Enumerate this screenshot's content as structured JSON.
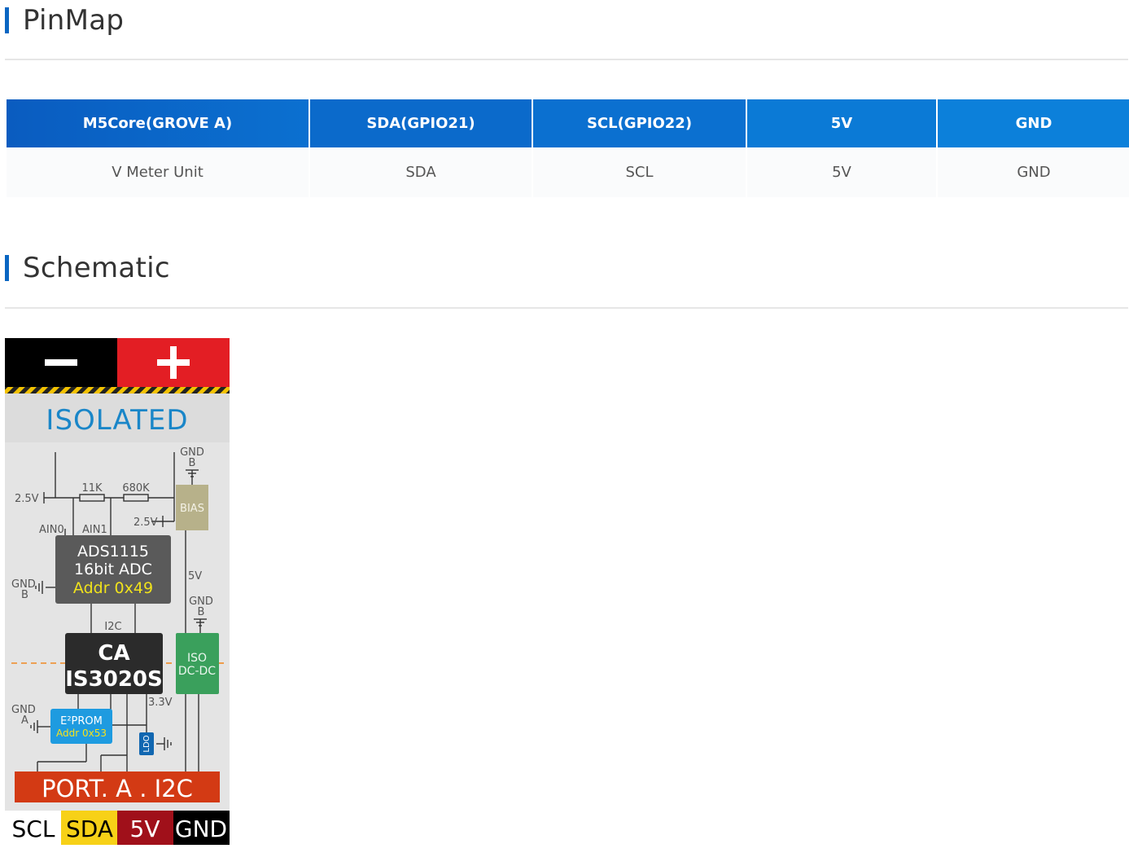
{
  "pinmap": {
    "title": "PinMap",
    "headers": [
      "M5Core(GROVE A)",
      "SDA(GPIO21)",
      "SCL(GPIO22)",
      "5V",
      "GND"
    ],
    "row": [
      "V Meter Unit",
      "SDA",
      "SCL",
      "5V",
      "GND"
    ]
  },
  "schematic": {
    "title": "Schematic",
    "isolated": "ISOLATED",
    "r1": "11K",
    "r2": "680K",
    "v25_left": "2.5V",
    "v25_right": "2.5V",
    "ain0": "AIN0",
    "ain1": "AIN1",
    "gndb_top_1": "GND",
    "gndb_top_2": "B",
    "bias": "BIAS",
    "adc_line1": "ADS1115",
    "adc_line2": "16bit ADC",
    "adc_line3": "Addr 0x49",
    "gndb_left_1": "GND",
    "gndb_left_2": "B",
    "v5": "5V",
    "gndb_mid_1": "GND",
    "gndb_mid_2": "B",
    "i2c": "I2C",
    "ca_line1": "CA",
    "ca_line2": "IS3020S",
    "iso_line1": "ISO",
    "iso_line2": "DC-DC",
    "v33": "3.3V",
    "gnda_1": "GND",
    "gnda_2": "A",
    "eeprom_line1": "E²PROM",
    "eeprom_line2": "Addr 0x53",
    "ldo": "LDO",
    "port": "PORT. A . I2C",
    "pins": [
      "SCL",
      "SDA",
      "5V",
      "GND"
    ],
    "colors": {
      "accent": "#0a66c2",
      "red": "#e31e24",
      "orange_red": "#d33a14",
      "bias": "#b7b18a",
      "adc": "#5a5a5a",
      "chip": "#2b2b2b",
      "iso": "#3aa05c",
      "eeprom": "#1e9be0",
      "ldo": "#1167b1",
      "sda": "#f7d117",
      "v5": "#a0101a"
    }
  }
}
